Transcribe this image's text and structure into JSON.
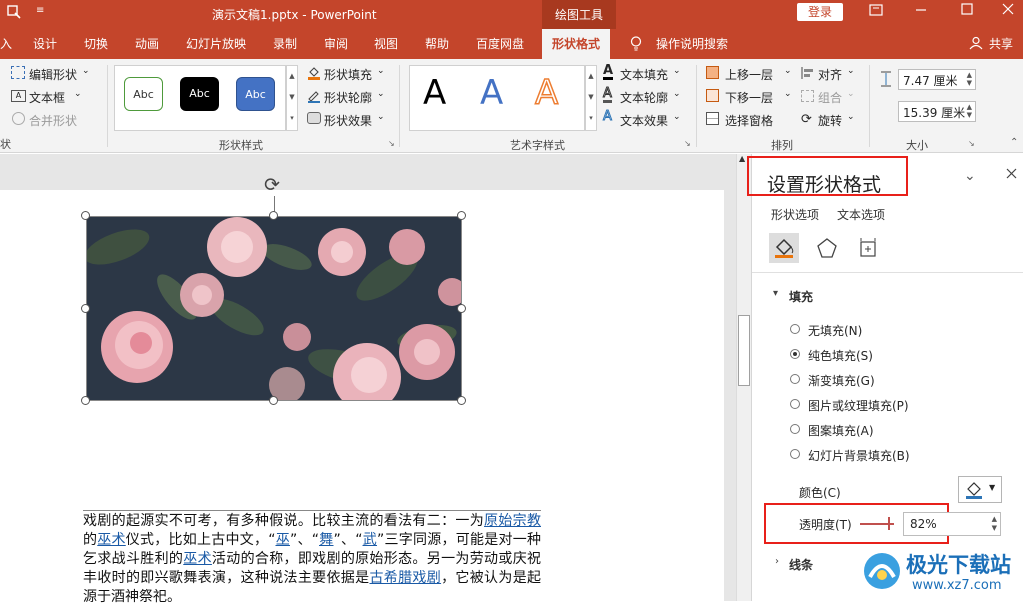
{
  "titlebar": {
    "file_title": "演示文稿1.pptx - PowerPoint",
    "context_label": "绘图工具",
    "login_label": "登录"
  },
  "tabs": [
    "入",
    "设计",
    "切换",
    "动画",
    "幻灯片放映",
    "录制",
    "审阅",
    "视图",
    "帮助",
    "百度网盘",
    "形状格式"
  ],
  "tell_me": "操作说明搜索",
  "share_label": "共享",
  "ribbon": {
    "insert_shape": {
      "edit_shape": "编辑形状",
      "text_box": "文本框",
      "merge_shapes": "合并形状"
    },
    "shape_styles": {
      "style_labels": [
        "Abc",
        "Abc",
        "Abc"
      ],
      "fill": "形状填充",
      "outline": "形状轮廓",
      "effects": "形状效果",
      "group_label": "形状样式"
    },
    "wordart": {
      "samples": [
        "A",
        "A",
        "A"
      ],
      "text_fill": "文本填充",
      "text_outline": "文本轮廓",
      "text_effects": "文本效果",
      "group_label": "艺术字样式"
    },
    "arrange": {
      "bring_forward": "上移一层",
      "send_backward": "下移一层",
      "selection_pane": "选择窗格",
      "align": "对齐",
      "group": "组合",
      "rotate": "旋转",
      "group_label": "排列"
    },
    "size": {
      "height": "7.47 厘米",
      "width": "15.39 厘米",
      "group_label": "大小"
    }
  },
  "slide": {
    "paragraph": [
      {
        "t": "戏剧的起源实不可考，有多种假说。比较主流的看法有二：一为"
      },
      {
        "t": "原始宗教",
        "link": true
      },
      {
        "t": "的"
      },
      {
        "t": "巫术",
        "link": true
      },
      {
        "t": "仪式，比如上古中文，“"
      },
      {
        "t": "巫",
        "link": true
      },
      {
        "t": "”、“"
      },
      {
        "t": "舞",
        "link": true
      },
      {
        "t": "”、“"
      },
      {
        "t": "武",
        "link": true
      },
      {
        "t": "”三字同源，可能是对一种乞求战斗胜利的"
      },
      {
        "t": "巫术",
        "link": true
      },
      {
        "t": "活动的合称，即戏剧的原始形态。另一为劳动或庆祝丰收时的即兴歌舞表演，这种说法主要依据是"
      },
      {
        "t": "古希腊戏剧",
        "link": true
      },
      {
        "t": "，它被认为是起源于酒神祭祀。"
      }
    ]
  },
  "pane": {
    "title": "设置形状格式",
    "tab_shape": "形状选项",
    "tab_text": "文本选项",
    "section_fill": "填充",
    "fill_options": [
      "无填充(N)",
      "纯色填充(S)",
      "渐变填充(G)",
      "图片或纹理填充(P)",
      "图案填充(A)",
      "幻灯片背景填充(B)"
    ],
    "selected_fill": 1,
    "color_label": "颜色(C)",
    "transparency_label": "透明度(T)",
    "transparency_value": "82%",
    "transparency_fraction": 0.82,
    "section_line": "线条"
  },
  "colors": {
    "accent": "#c4452b",
    "highlight": "#e8201a"
  },
  "watermark": {
    "brand": "极光下载站",
    "url": "www.xz7.com"
  }
}
